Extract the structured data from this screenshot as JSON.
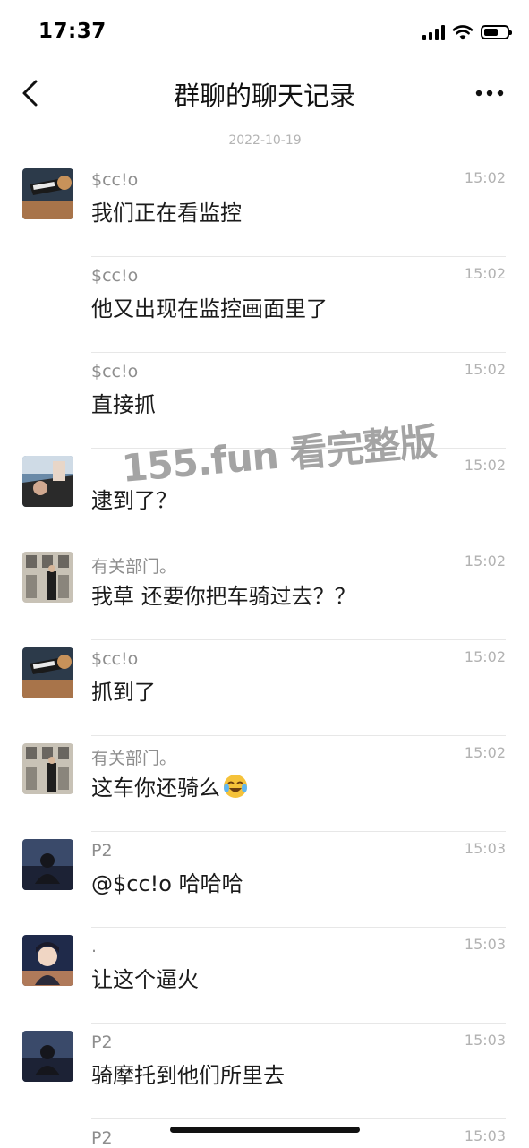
{
  "status_bar": {
    "time": "17:37"
  },
  "nav": {
    "title": "群聊的聊天记录"
  },
  "date_divider": "2022-10-19",
  "messages": [
    {
      "sender": "$cc!o",
      "time": "15:02",
      "text": "我们正在看监控",
      "avatar": "avatar-cclo"
    },
    {
      "sender": "$cc!o",
      "time": "15:02",
      "text": "他又出现在监控画面里了",
      "avatar": ""
    },
    {
      "sender": "$cc!o",
      "time": "15:02",
      "text": "直接抓",
      "avatar": ""
    },
    {
      "sender": "",
      "time": "15:02",
      "text": "逮到了？",
      "avatar": "avatar-driver"
    },
    {
      "sender": "有关部门。",
      "time": "15:02",
      "text": "我草 还要你把车骑过去？？",
      "avatar": "avatar-building"
    },
    {
      "sender": "$cc!o",
      "time": "15:02",
      "text": "抓到了",
      "avatar": "avatar-cclo"
    },
    {
      "sender": "有关部门。",
      "time": "15:02",
      "text": "这车你还骑么",
      "avatar": "avatar-building",
      "emoji": "laughing-crying-emoji"
    },
    {
      "sender": "P2",
      "time": "15:03",
      "text": "@$cc!o 哈哈哈",
      "avatar": "avatar-p2"
    },
    {
      "sender": ".",
      "time": "15:03",
      "text": "让这个逼火",
      "avatar": "avatar-anime"
    },
    {
      "sender": "P2",
      "time": "15:03",
      "text": "骑摩托到他们所里去",
      "avatar": "avatar-p2"
    },
    {
      "sender": "P2",
      "time": "15:03",
      "text": "",
      "avatar": ""
    }
  ],
  "watermark": "155.fun 看完整版",
  "colors": {
    "separator": "#e7e7e7",
    "meta_text": "#8e8e8e",
    "time_text": "#b2b2b2"
  }
}
